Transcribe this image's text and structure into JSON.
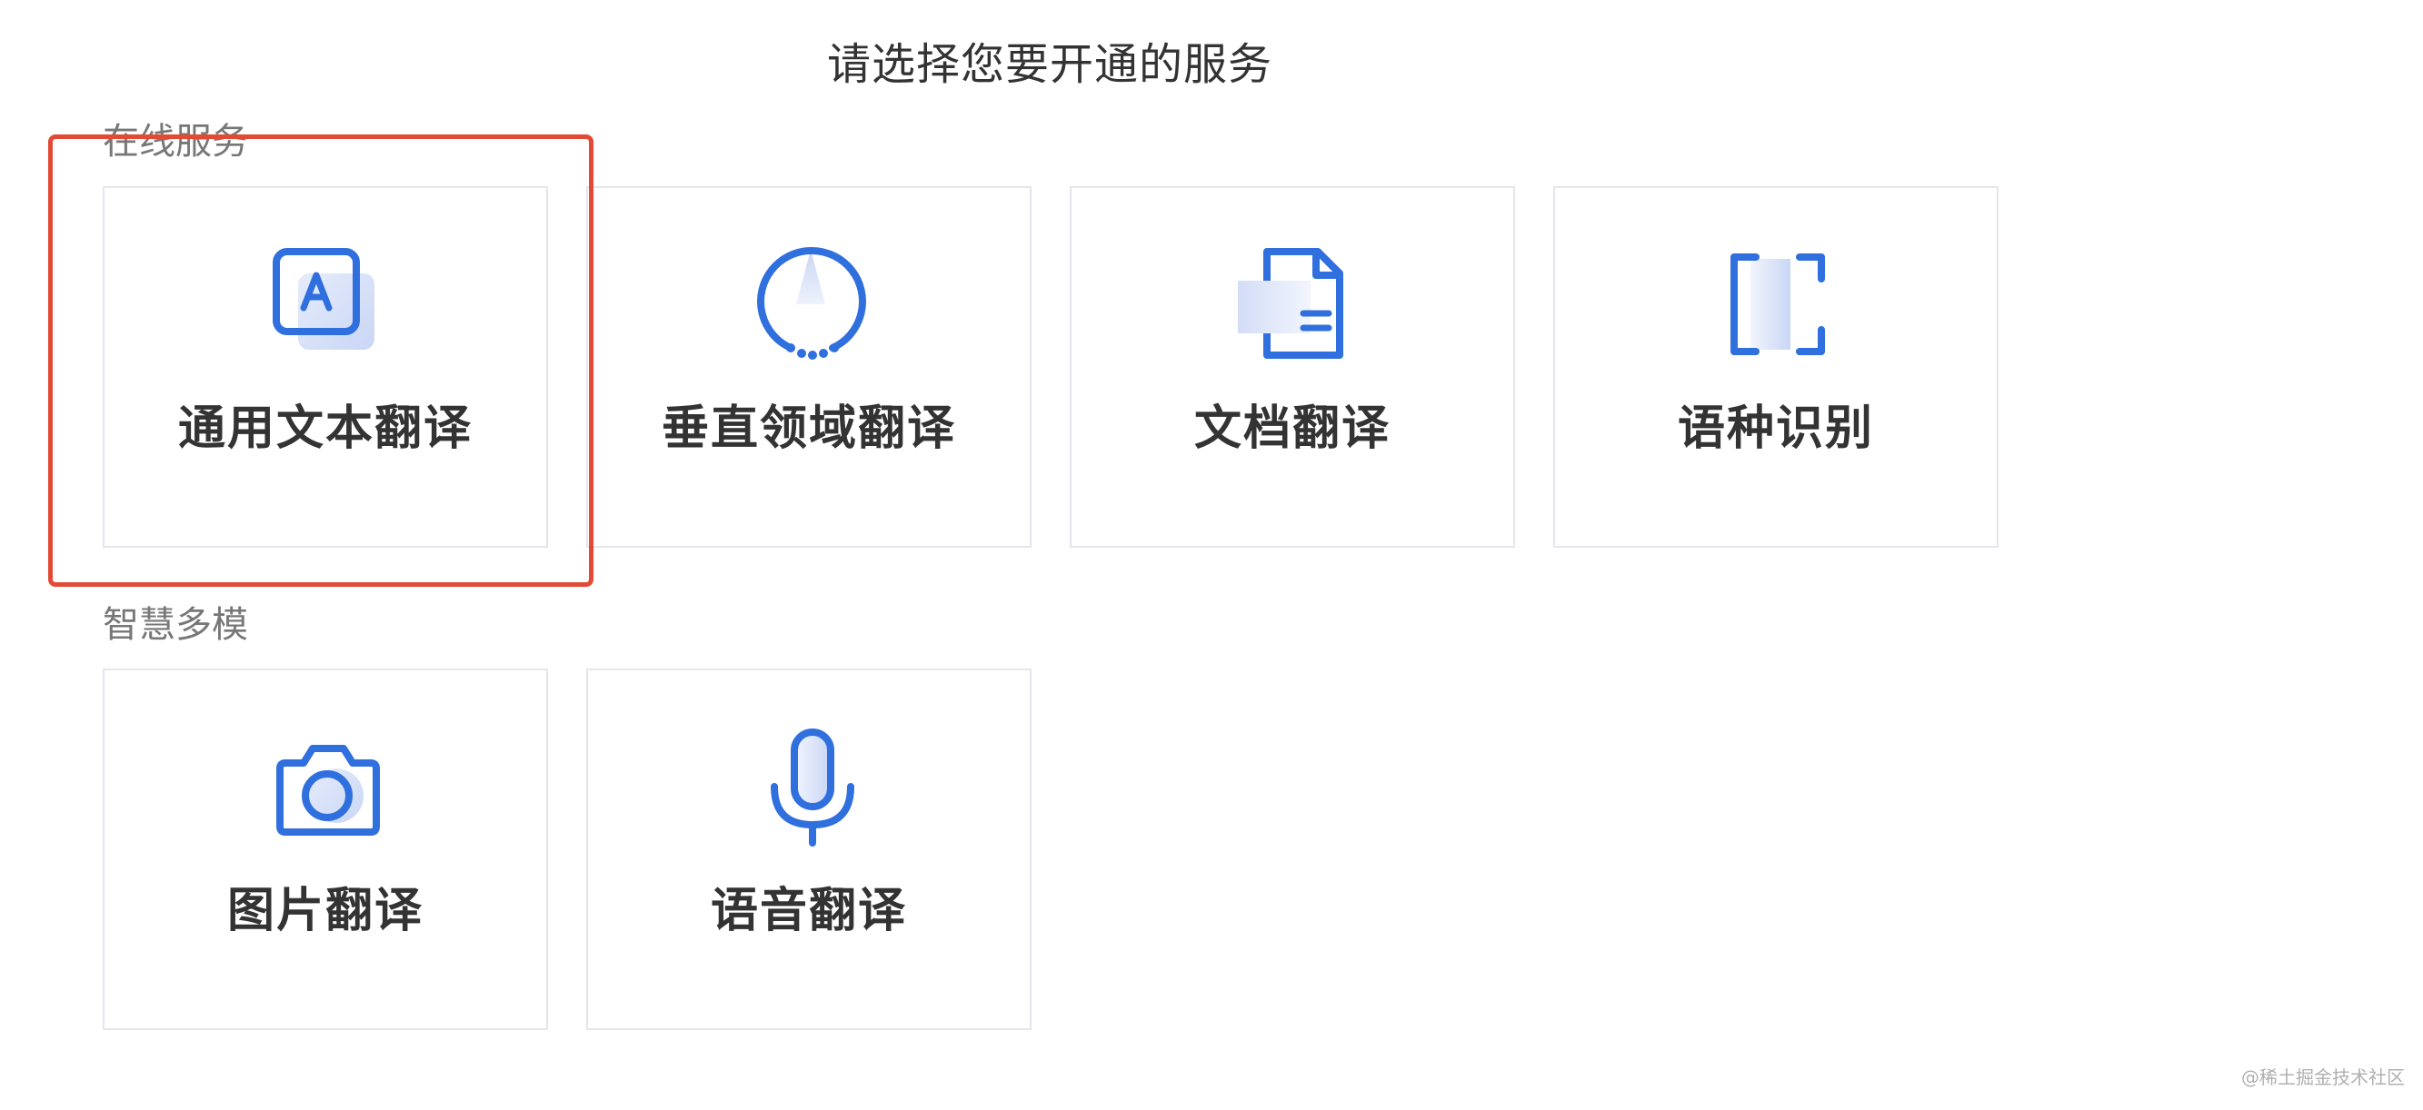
{
  "page": {
    "title": "请选择您要开通的服务"
  },
  "sections": [
    {
      "label": "在线服务",
      "cards": [
        {
          "label": "通用文本翻译",
          "icon": "text-translate-icon"
        },
        {
          "label": "垂直领域翻译",
          "icon": "domain-compass-icon"
        },
        {
          "label": "文档翻译",
          "icon": "document-icon"
        },
        {
          "label": "语种识别",
          "icon": "language-detect-icon"
        }
      ]
    },
    {
      "label": "智慧多模",
      "cards": [
        {
          "label": "图片翻译",
          "icon": "camera-icon"
        },
        {
          "label": "语音翻译",
          "icon": "microphone-icon"
        }
      ]
    }
  ],
  "watermark": "@稀土掘金技术社区",
  "colors": {
    "accent": "#2f6fde",
    "highlight": "#e34a35",
    "card_border": "#e4e6eb"
  }
}
